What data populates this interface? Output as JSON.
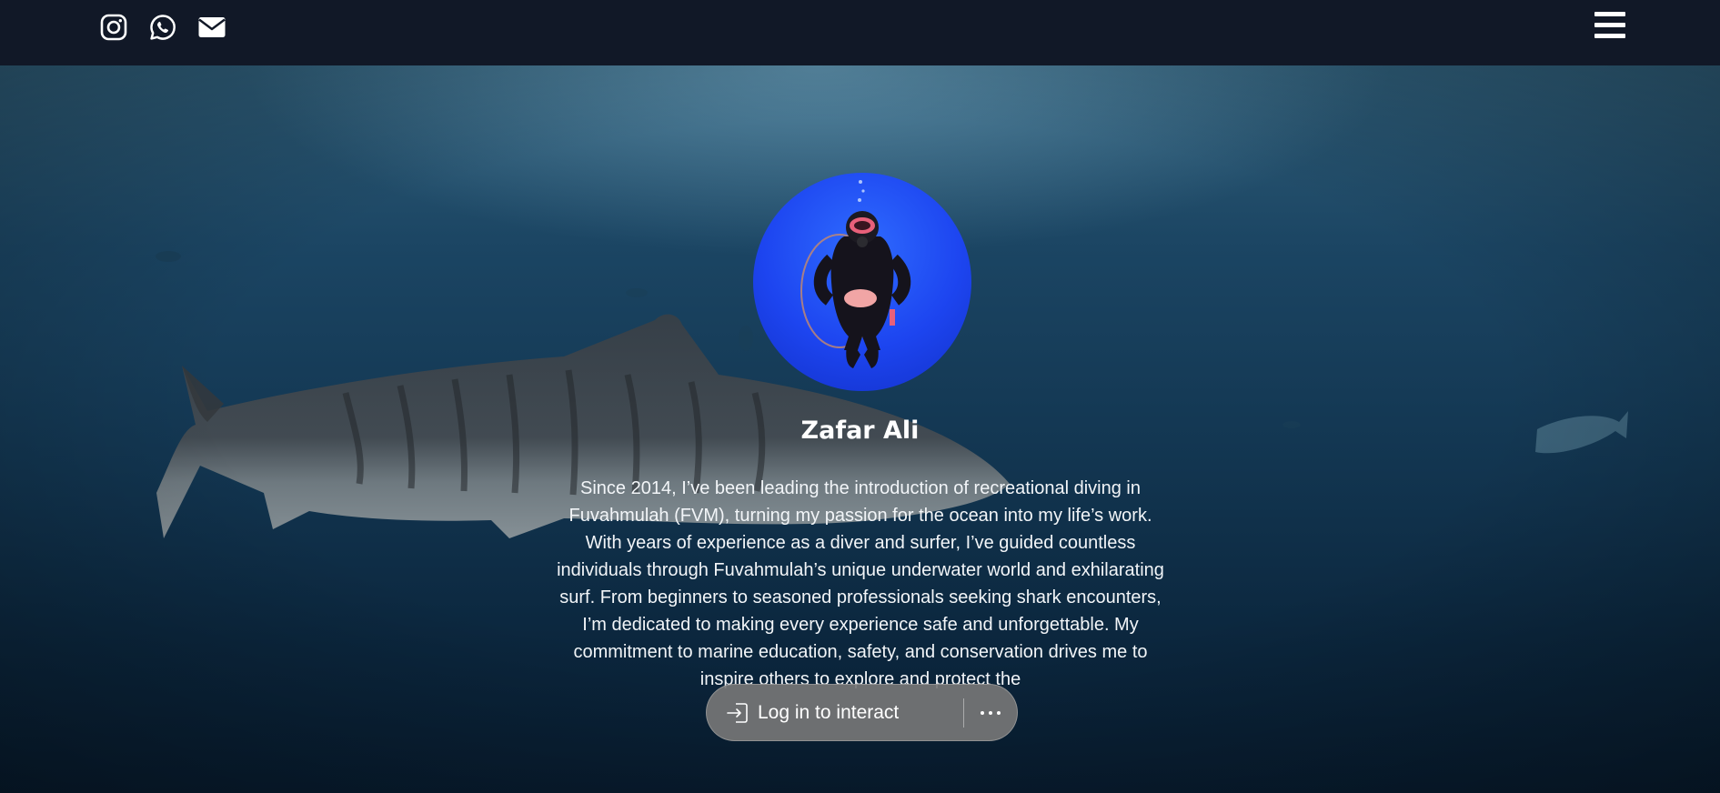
{
  "header": {
    "social_icons": [
      "instagram-icon",
      "whatsapp-icon",
      "envelope-icon"
    ],
    "menu_icon": "hamburger-menu-icon",
    "background_color": "#111827"
  },
  "profile": {
    "name": "Zafar Ali",
    "bio": "Since 2014, I’ve been leading the introduction of recreational diving in Fuvahmulah (FVM), turning my passion for the ocean into my life’s work. With years of experience as a diver and surfer, I’ve guided countless individuals through Fuvahmulah’s unique underwater world and exhilarating surf. From beginners to seasoned professionals seeking shark encounters, I’m dedicated to making every experience safe and unforgettable. My commitment to marine education, safety, and conservation drives me to inspire others to explore and protect the"
  },
  "login_prompt": {
    "label": "Log in to interact",
    "icon": "login-arrow-icon",
    "more_icon": "ellipsis-icon"
  },
  "colors": {
    "ocean_dark": "#0b263d",
    "ocean_light": "#2e5c77",
    "avatar_blue": "#1d45f0",
    "pill": "#767676"
  }
}
